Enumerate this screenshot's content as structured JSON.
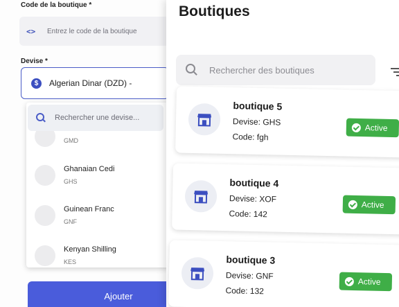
{
  "form": {
    "code_label": "Code de la boutique *",
    "code_placeholder": "Entrez le code de la boutique",
    "currency_label": "Devise *",
    "currency_value": "Algerian Dinar (DZD) -",
    "add_label": "Ajouter"
  },
  "dropdown": {
    "search_placeholder": "Rechercher une devise...",
    "items": [
      {
        "name": "",
        "code": "GMD"
      },
      {
        "name": "Ghanaian Cedi",
        "code": "GHS"
      },
      {
        "name": "Guinean Franc",
        "code": "GNF"
      },
      {
        "name": "Kenyan Shilling",
        "code": "KES"
      }
    ]
  },
  "list": {
    "title": "Boutiques",
    "search_placeholder": "Rechercher des boutiques",
    "cards": [
      {
        "name": "boutique 5",
        "currency": "Devise: GHS",
        "code": "Code: fgh",
        "status": "Active"
      },
      {
        "name": "boutique 4",
        "currency": "Devise: XOF",
        "code": "Code: 142",
        "status": "Active"
      },
      {
        "name": "boutique 3",
        "currency": "Devise: GNF",
        "code": "Code: 132",
        "status": "Active"
      }
    ]
  },
  "colors": {
    "primary": "#4a5cdb",
    "active_green": "#3fae47",
    "store_icon": "#3c4fc0"
  },
  "icons": {
    "code": "code-brackets-icon",
    "currency": "dollar-circle-icon",
    "search": "search-icon",
    "filter": "filter-icon",
    "store": "storefront-icon",
    "check": "check-circle-icon"
  }
}
